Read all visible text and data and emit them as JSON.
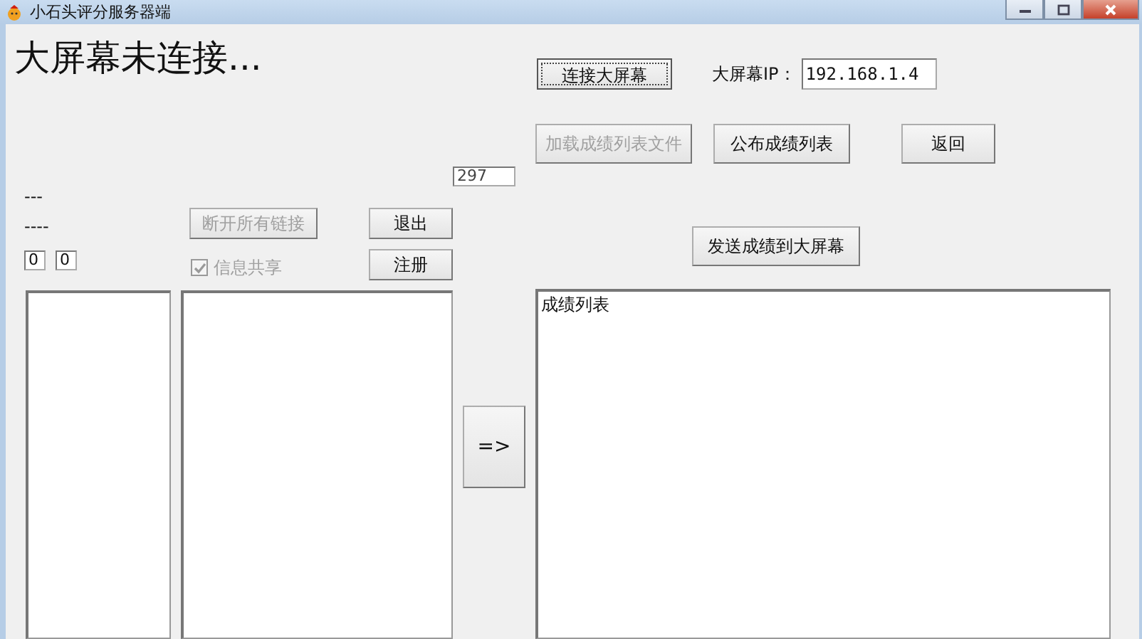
{
  "window": {
    "title": "小石头评分服务器端"
  },
  "status": "大屏幕未连接...",
  "counter_field": {
    "value": "297"
  },
  "labels": [
    "---",
    "----"
  ],
  "disconnect_button": {
    "label": "断开所有链接",
    "disabled": true
  },
  "exit_button": {
    "label": "退出",
    "disabled": false
  },
  "small_fields": [
    {
      "value": "0"
    },
    {
      "value": "0"
    }
  ],
  "share_checkbox": {
    "label": "信息共享",
    "checked": true,
    "disabled": true
  },
  "register_button": {
    "label": "注册",
    "disabled": false
  },
  "transfer_button": {
    "label": "=>",
    "disabled": false
  },
  "connect_button": {
    "label": "连接大屏幕",
    "focused": true
  },
  "ip": {
    "label": "大屏幕IP：",
    "value": "192.168.1.4"
  },
  "file_buttons": [
    {
      "label": "加载成绩列表文件",
      "disabled": true
    },
    {
      "label": "公布成绩列表",
      "disabled": false
    },
    {
      "label": "返回",
      "disabled": false
    }
  ],
  "send_button": {
    "label": "发送成绩到大屏幕",
    "disabled": false
  },
  "score_list": {
    "text": "成绩列表"
  }
}
